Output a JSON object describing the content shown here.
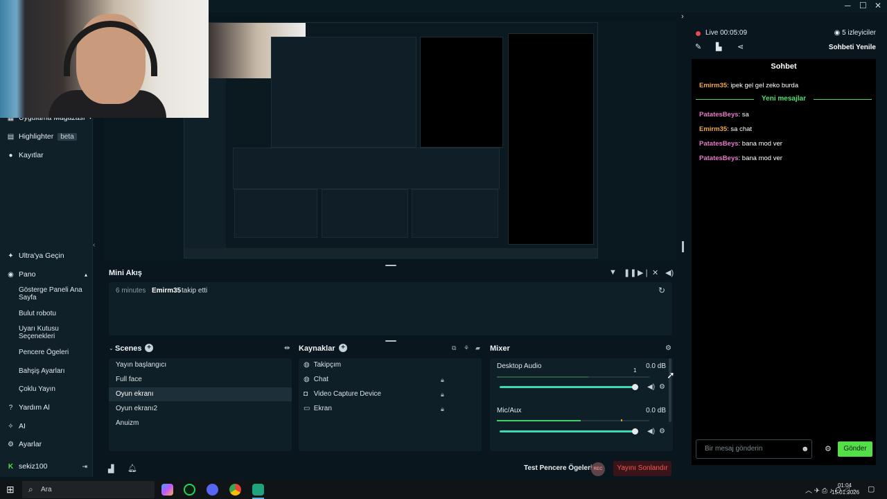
{
  "sidebar": {
    "items": [
      {
        "label": "Uygulama Mağazası",
        "icon": "store-icon"
      },
      {
        "label": "Highlighter",
        "badge": "beta",
        "icon": "highlighter-icon"
      },
      {
        "label": "Kayıtlar",
        "icon": "play-circle-icon"
      },
      {
        "label": "Ultra'ya Geçin",
        "icon": "ultra-icon"
      },
      {
        "label": "Pano",
        "icon": "dashboard-icon"
      },
      {
        "label": "Yardım Al",
        "icon": "help-icon"
      },
      {
        "label": "AI",
        "icon": "sparkle-icon"
      },
      {
        "label": "Ayarlar",
        "icon": "gear-icon"
      },
      {
        "label": "sekiz100",
        "icon": "kick-logo-icon"
      }
    ],
    "subitems": [
      "Gösterge Paneli Ana Sayfa",
      "Bulut robotu",
      "Uyarı Kutusu Seçenekleri",
      "Pencere Ögeleri",
      "Bahşiş Ayarları",
      "Çoklu Yayın"
    ]
  },
  "miniflow": {
    "title": "Mini Akış",
    "event": {
      "time": "6 minutes",
      "user": "Emirm35",
      "action": "takip etti"
    }
  },
  "scenes": {
    "title": "Scenes",
    "items": [
      "Yayın başlangıcı",
      "Full face",
      "Oyun ekranı",
      "Oyun ekranı2",
      "Anuizm"
    ],
    "active": "Oyun ekranı"
  },
  "sources": {
    "title": "Kaynaklar",
    "items": [
      {
        "label": "Takipçım",
        "icon": "globe-icon"
      },
      {
        "label": "Chat",
        "icon": "globe-icon"
      },
      {
        "label": "Video Capture Device",
        "icon": "webcam-icon"
      },
      {
        "label": "Ekran",
        "icon": "monitor-icon"
      }
    ]
  },
  "mixer": {
    "title": "Mixer",
    "channels": [
      {
        "name": "Desktop Audio",
        "db": "0.0 dB",
        "marker": "1"
      },
      {
        "name": "Mic/Aux",
        "db": "0.0 dB"
      }
    ]
  },
  "bottombar": {
    "test_label": "Test Pencere Ögeleri",
    "rec_label": "REC",
    "stop_label": "Yayını Sonlandır"
  },
  "live": {
    "status": "Live 00:05:09",
    "viewers": "5 izleyiciler",
    "refresh_label": "Sohbeti Yenile"
  },
  "chat": {
    "title": "Sohbet",
    "new_messages_label": "Yeni mesajlar",
    "messages": [
      {
        "user": "Emirm35",
        "text": "ipek gel gel zeko burda",
        "color": "#f0a94a"
      },
      {
        "user": "PatatesBeys",
        "text": "sa",
        "color": "#e879c9"
      },
      {
        "user": "Emirm35",
        "text": "sa chat",
        "color": "#f0a94a"
      },
      {
        "user": "PatatesBeys",
        "text": "bana mod ver",
        "color": "#e879c9"
      },
      {
        "user": "PatatesBeys",
        "text": "bana mod ver",
        "color": "#e879c9"
      }
    ],
    "input_placeholder": "Bir mesaj gönderin",
    "send_label": "Gönder"
  },
  "taskbar": {
    "search_placeholder": "Ara",
    "time": "01:04",
    "date": "15.01.2026"
  },
  "colors": {
    "accent_green": "#52e046",
    "slider_teal": "#3fd8b4",
    "live_red": "#e74b4b"
  }
}
